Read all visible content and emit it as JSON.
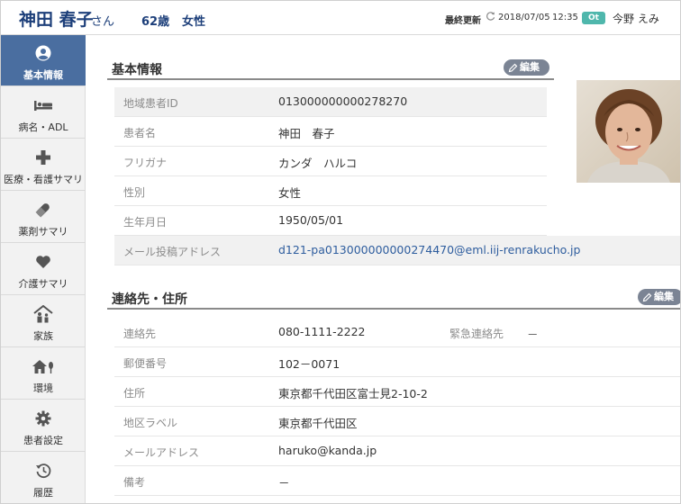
{
  "header": {
    "patient_name": "神田 春子",
    "honorific": "さん",
    "age": "62歳",
    "sex": "女性",
    "last_updated_label": "最終更新",
    "last_updated_date": "2018/07/05",
    "last_updated_time": "12:35",
    "user_badge": "Ot",
    "user_name": "今野 えみ"
  },
  "sidebar": {
    "items": [
      {
        "label": "基本情報",
        "icon": "user-circle-icon",
        "active": true
      },
      {
        "label": "病名・ADL",
        "icon": "bed-icon"
      },
      {
        "label": "医療・看護サマリ",
        "icon": "plus-icon"
      },
      {
        "label": "薬剤サマリ",
        "icon": "pill-icon"
      },
      {
        "label": "介護サマリ",
        "icon": "heart-icon"
      },
      {
        "label": "家族",
        "icon": "family-house-icon"
      },
      {
        "label": "環境",
        "icon": "home-tree-icon"
      },
      {
        "label": "患者設定",
        "icon": "gear-icon"
      },
      {
        "label": "履歴",
        "icon": "history-icon"
      }
    ]
  },
  "basic_info": {
    "title": "基本情報",
    "edit_label": "編集",
    "rows": [
      {
        "label": "地域患者ID",
        "value": "013000000000278270"
      },
      {
        "label": "患者名",
        "value": "神田　春子"
      },
      {
        "label": "フリガナ",
        "value": "カンダ　ハルコ"
      },
      {
        "label": "性別",
        "value": "女性"
      },
      {
        "label": "生年月日",
        "value": "1950/05/01"
      },
      {
        "label": "メール投稿アドレス",
        "value": "d121-pa013000000000274470@eml.iij-renrakucho.jp"
      }
    ]
  },
  "contact": {
    "title": "連絡先・住所",
    "edit_label": "編集",
    "rows": [
      {
        "label": "連絡先",
        "value": "080-1111-2222",
        "label2": "緊急連絡先",
        "value2": "－"
      },
      {
        "label": "郵便番号",
        "value": "102－0071"
      },
      {
        "label": "住所",
        "value": "東京都千代田区富士見2-10-2"
      },
      {
        "label": "地区ラベル",
        "value": "東京都千代田区"
      },
      {
        "label": "メールアドレス",
        "value": "haruko@kanda.jp"
      },
      {
        "label": "備考",
        "value": "－"
      }
    ]
  },
  "colors": {
    "accent": "#1d3f7a",
    "sidebar_active": "#4a6ea0",
    "badge": "#4fb7ac",
    "edit_button": "#7b8494",
    "link": "#2e5d9e"
  }
}
